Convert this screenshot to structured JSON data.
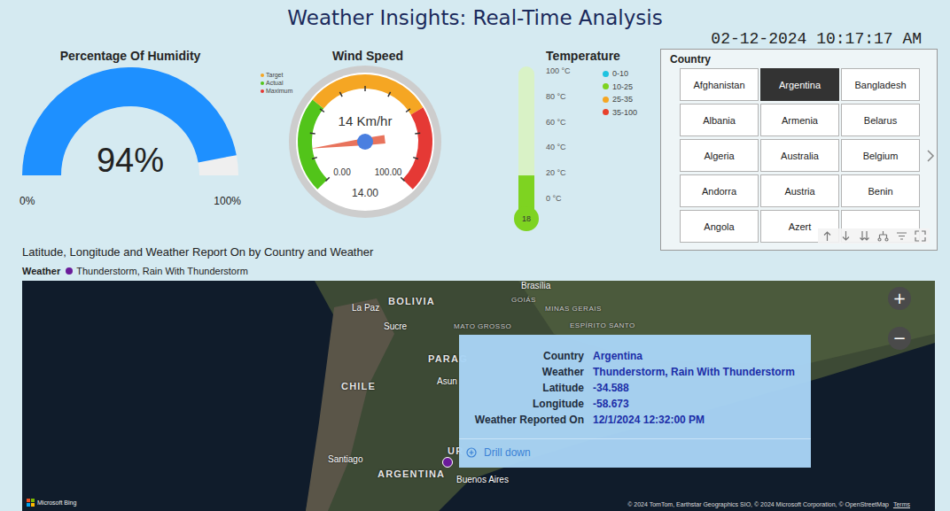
{
  "header": {
    "title": "Weather Insights: Real-Time Analysis",
    "datetime": "02-12-2024 10:17:17 AM"
  },
  "humidity": {
    "title": "Percentage Of Humidity",
    "value": "94%",
    "min": "0%",
    "max": "100%",
    "level": 0.94
  },
  "wind": {
    "title": "Wind Speed",
    "legend": [
      {
        "label": "Target",
        "color": "#f5a623"
      },
      {
        "label": "Actual",
        "color": "#52c41a"
      },
      {
        "label": "Maximum",
        "color": "#e53935"
      }
    ],
    "reading": "14 Km/hr",
    "min": "0.00",
    "max": "100.00",
    "value": "14.00",
    "level": 0.14,
    "ranges": [
      {
        "color": "#52c41a",
        "level": 0.31
      },
      {
        "color": "#f5a623",
        "level": 0.72
      },
      {
        "color": "#e53935",
        "level": 1
      }
    ]
  },
  "temperature": {
    "title": "Temperature",
    "ticks": [
      "100 °C",
      "80 °C",
      "60 °C",
      "40 °C",
      "20 °C",
      "0 °C"
    ],
    "value": "18",
    "level": 0.18,
    "color": "#7ed321",
    "legend": [
      {
        "label": "0-10",
        "color": "#1fc3e0"
      },
      {
        "label": "10-25",
        "color": "#7ed321"
      },
      {
        "label": "25-35",
        "color": "#f5a623"
      },
      {
        "label": "35-100",
        "color": "#e8412c"
      }
    ]
  },
  "slicer": {
    "title": "Country",
    "items": [
      {
        "label": "Afghanistan",
        "selected": false
      },
      {
        "label": "Argentina",
        "selected": true
      },
      {
        "label": "Bangladesh",
        "selected": false
      },
      {
        "label": "Albania",
        "selected": false
      },
      {
        "label": "Armenia",
        "selected": false
      },
      {
        "label": "Belarus",
        "selected": false
      },
      {
        "label": "Algeria",
        "selected": false
      },
      {
        "label": "Australia",
        "selected": false
      },
      {
        "label": "Belgium",
        "selected": false
      },
      {
        "label": "Andorra",
        "selected": false
      },
      {
        "label": "Austria",
        "selected": false
      },
      {
        "label": "Benin",
        "selected": false
      },
      {
        "label": "Angola",
        "selected": false
      },
      {
        "label": "Azert",
        "selected": false
      }
    ]
  },
  "map": {
    "title": "Latitude, Longitude and Weather Report On by Country and Weather",
    "legend_title": "Weather",
    "legend": [
      {
        "label": "Thunderstorm, Rain With Thunderstorm",
        "color": "#6a1b9a"
      }
    ],
    "labels": [
      {
        "text": "BOLIVIA",
        "kind": "country"
      },
      {
        "text": "La Paz",
        "kind": "city"
      },
      {
        "text": "Sucre",
        "kind": "city"
      },
      {
        "text": "Brasília",
        "kind": "city"
      },
      {
        "text": "GOIÁS",
        "kind": "state"
      },
      {
        "text": "MINAS GERAIS",
        "kind": "state"
      },
      {
        "text": "MATO GROSSO",
        "kind": "state"
      },
      {
        "text": "ESPÍRITO SANTO",
        "kind": "state"
      },
      {
        "text": "PARAG",
        "kind": "country"
      },
      {
        "text": "CHILE",
        "kind": "country"
      },
      {
        "text": "Asun",
        "kind": "city"
      },
      {
        "text": "Santiago",
        "kind": "city"
      },
      {
        "text": "ARGENTINA",
        "kind": "country"
      },
      {
        "text": "Buenos Aires",
        "kind": "city"
      },
      {
        "text": "UR",
        "kind": "country"
      }
    ],
    "tooltip": {
      "rows": [
        {
          "label": "Country",
          "value": "Argentina"
        },
        {
          "label": "Weather",
          "value": "Thunderstorm, Rain With Thunderstorm"
        },
        {
          "label": "Latitude",
          "value": "-34.588"
        },
        {
          "label": "Longitude",
          "value": "-58.673"
        },
        {
          "label": "Weather Reported On",
          "value": "12/1/2024 12:32:00 PM"
        }
      ],
      "action": "Drill down"
    },
    "zoom": [
      "+",
      "−"
    ],
    "attribution": "© 2024 TomTom, Earthstar Geographics SIO, © 2024 Microsoft Corporation, © OpenStreetMap",
    "terms": "Terms",
    "brand": "Microsoft Bing"
  }
}
